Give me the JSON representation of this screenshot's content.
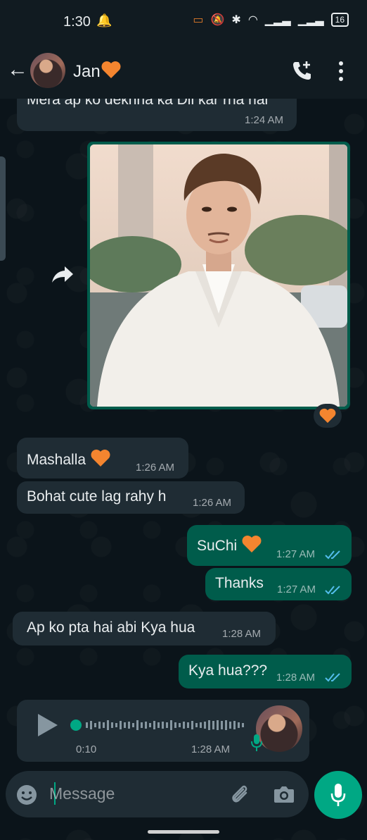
{
  "status_bar": {
    "time": "1:30",
    "battery": "16"
  },
  "header": {
    "contact_name": "Jan"
  },
  "messages": [
    {
      "dir": "in",
      "text": "Mera ap ko dekhna ka Dil kar rha hai",
      "time": "1:24 AM"
    },
    {
      "dir": "out",
      "type": "image",
      "description": "photo"
    },
    {
      "dir": "in",
      "text": "Mashalla",
      "time": "1:26 AM"
    },
    {
      "dir": "in",
      "text": "Bohat cute lag rahy h",
      "time": "1:26 AM"
    },
    {
      "dir": "out",
      "text": "SuChi",
      "time": "1:27 AM"
    },
    {
      "dir": "out",
      "text": "Thanks",
      "time": "1:27 AM"
    },
    {
      "dir": "in",
      "text": "Ap ko pta hai abi Kya hua",
      "time": "1:28 AM"
    },
    {
      "dir": "out",
      "text": "Kya hua???",
      "time": "1:28 AM"
    },
    {
      "dir": "in",
      "type": "voice",
      "duration": "0:10",
      "time": "1:28 AM"
    }
  ],
  "input": {
    "placeholder": "Message"
  },
  "colors": {
    "incoming_bubble": "#1f2c34",
    "outgoing_bubble": "#005c4b",
    "accent": "#00a884",
    "read_ticks": "#53bdeb"
  }
}
